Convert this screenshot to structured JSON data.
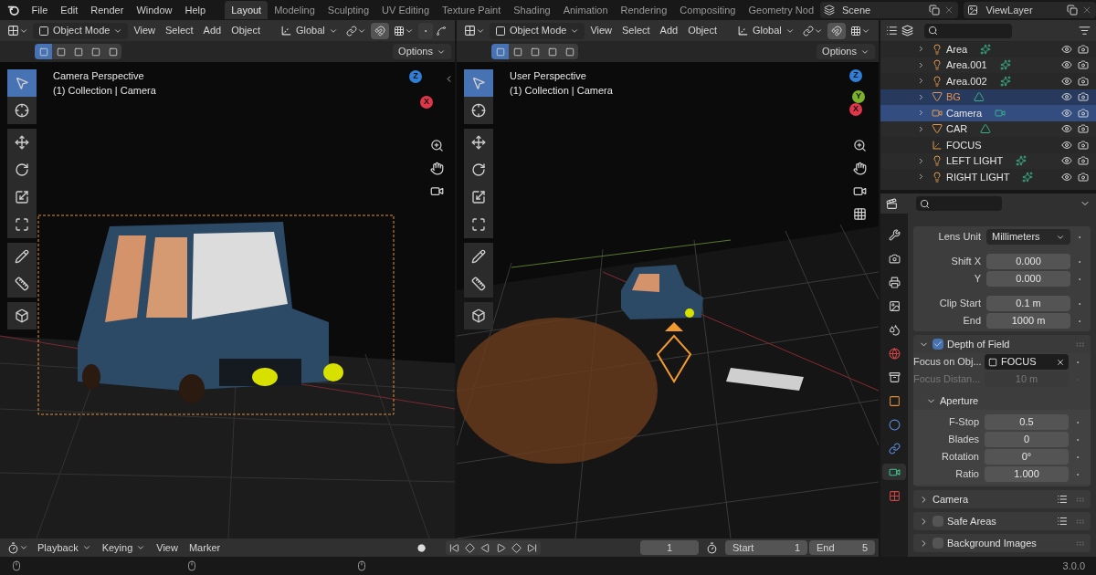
{
  "menu": [
    "File",
    "Edit",
    "Render",
    "Window",
    "Help"
  ],
  "workspaces": [
    {
      "label": "Layout",
      "selected": true
    },
    {
      "label": "Modeling",
      "selected": false
    },
    {
      "label": "Sculpting",
      "selected": false
    },
    {
      "label": "UV Editing",
      "selected": false
    },
    {
      "label": "Texture Paint",
      "selected": false
    },
    {
      "label": "Shading",
      "selected": false
    },
    {
      "label": "Animation",
      "selected": false
    },
    {
      "label": "Rendering",
      "selected": false
    },
    {
      "label": "Compositing",
      "selected": false
    },
    {
      "label": "Geometry Nod",
      "selected": false
    }
  ],
  "scene": "Scene",
  "view_layer": "ViewLayer",
  "viewports": [
    {
      "mode": "Object Mode",
      "menus": [
        "View",
        "Select",
        "Add",
        "Object"
      ],
      "orientation": "Global",
      "options": "Options",
      "title": "Camera Perspective",
      "subtitle": "(1) Collection | Camera",
      "sidebar_arrow": true,
      "select_modes": [
        {
          "selected": true
        },
        {
          "selected": false
        },
        {
          "selected": false
        },
        {
          "selected": false
        },
        {
          "selected": false
        }
      ],
      "tools": [
        {
          "selected": true
        },
        {
          "selected": false
        },
        {
          "selected": false
        },
        {
          "selected": false
        },
        {
          "selected": false
        },
        {
          "selected": false
        },
        {
          "selected": false
        },
        {
          "selected": false
        },
        {
          "selected": false
        }
      ],
      "gizmo": [
        {
          "label": "Z",
          "color": "#2f7fd6"
        },
        {
          "label": "X",
          "color": "#e0364a"
        }
      ]
    },
    {
      "mode": "Object Mode",
      "menus": [
        "View",
        "Select",
        "Add",
        "Object"
      ],
      "orientation": "Global",
      "options": "Options",
      "title": "User Perspective",
      "subtitle": "(1) Collection | Camera",
      "sidebar_arrow": false,
      "select_modes": [
        {
          "selected": true
        },
        {
          "selected": false
        },
        {
          "selected": false
        },
        {
          "selected": false
        },
        {
          "selected": false
        }
      ],
      "tools": [
        {
          "selected": true
        },
        {
          "selected": false
        },
        {
          "selected": false
        },
        {
          "selected": false
        },
        {
          "selected": false
        },
        {
          "selected": false
        },
        {
          "selected": false
        },
        {
          "selected": false
        },
        {
          "selected": false
        }
      ],
      "gizmo": [
        {
          "label": "Z",
          "color": "#2f7fd6"
        },
        {
          "label": "Y",
          "color": "#7ab22a"
        },
        {
          "label": "X",
          "color": "#e0364a"
        }
      ]
    }
  ],
  "outliner": {
    "items": [
      {
        "name": "Area",
        "kind": "light",
        "expandable": true,
        "selected": false,
        "active": false
      },
      {
        "name": "Area.001",
        "kind": "light",
        "expandable": true,
        "selected": false,
        "active": false
      },
      {
        "name": "Area.002",
        "kind": "light",
        "expandable": true,
        "selected": false,
        "active": false
      },
      {
        "name": "BG",
        "kind": "mesh",
        "expandable": true,
        "selected": true,
        "active": false
      },
      {
        "name": "Camera",
        "kind": "camera",
        "expandable": true,
        "selected": true,
        "active": true
      },
      {
        "name": "CAR",
        "kind": "mesh",
        "expandable": true,
        "selected": false,
        "active": false
      },
      {
        "name": "FOCUS",
        "kind": "empty",
        "expandable": false,
        "selected": false,
        "active": false
      },
      {
        "name": "LEFT LIGHT",
        "kind": "light",
        "expandable": true,
        "selected": false,
        "active": false
      },
      {
        "name": "RIGHT LIGHT",
        "kind": "light",
        "expandable": true,
        "selected": false,
        "active": false
      }
    ]
  },
  "properties": {
    "tabs": [
      {
        "selected": false
      },
      {
        "selected": false
      },
      {
        "selected": false
      },
      {
        "selected": false
      },
      {
        "selected": false
      },
      {
        "selected": false
      },
      {
        "selected": false
      },
      {
        "selected": false
      },
      {
        "selected": false
      },
      {
        "selected": false
      },
      {
        "selected": true
      },
      {
        "selected": false
      }
    ],
    "lens_groups": [
      [
        {
          "kind": "dropdown",
          "label": "Lens Unit",
          "value": "Millimeters"
        }
      ],
      [
        {
          "kind": "number",
          "label": "Shift X",
          "value": "0.000"
        },
        {
          "kind": "number",
          "label": "Y",
          "value": "0.000"
        }
      ],
      [
        {
          "kind": "number",
          "label": "Clip Start",
          "value": "0.1 m"
        },
        {
          "kind": "number",
          "label": "End",
          "value": "1000 m"
        }
      ]
    ],
    "panels": [
      {
        "label": "Depth of Field",
        "checked": true,
        "expanded": true,
        "rows": [
          {
            "kind": "object",
            "label": "Focus on Obj...",
            "value": "FOCUS"
          },
          {
            "kind": "number",
            "label": "Focus Distan...",
            "value": "10 m",
            "disabled": true
          }
        ],
        "subpanels": [
          {
            "label": "Aperture",
            "expanded": true,
            "rows": [
              {
                "kind": "number",
                "label": "F-Stop",
                "value": "0.5"
              },
              {
                "kind": "number",
                "label": "Blades",
                "value": "0"
              },
              {
                "kind": "number",
                "label": "Rotation",
                "value": "0°"
              },
              {
                "kind": "number",
                "label": "Ratio",
                "value": "1.000"
              }
            ]
          }
        ]
      },
      {
        "label": "Camera",
        "expanded": false,
        "list_icon": true
      },
      {
        "label": "Safe Areas",
        "checked": false,
        "expanded": false,
        "list_icon": true
      },
      {
        "label": "Background Images",
        "checked": false,
        "expanded": false
      }
    ]
  },
  "timeline": {
    "menus": [
      {
        "label": "Playback",
        "dropdown": true
      },
      {
        "label": "Keying",
        "dropdown": true
      },
      {
        "label": "View",
        "dropdown": false
      },
      {
        "label": "Marker",
        "dropdown": false
      }
    ],
    "frame": "1",
    "start_label": "Start",
    "start": "1",
    "end_label": "End",
    "end": "5"
  },
  "status": {
    "version": "3.0.0"
  }
}
